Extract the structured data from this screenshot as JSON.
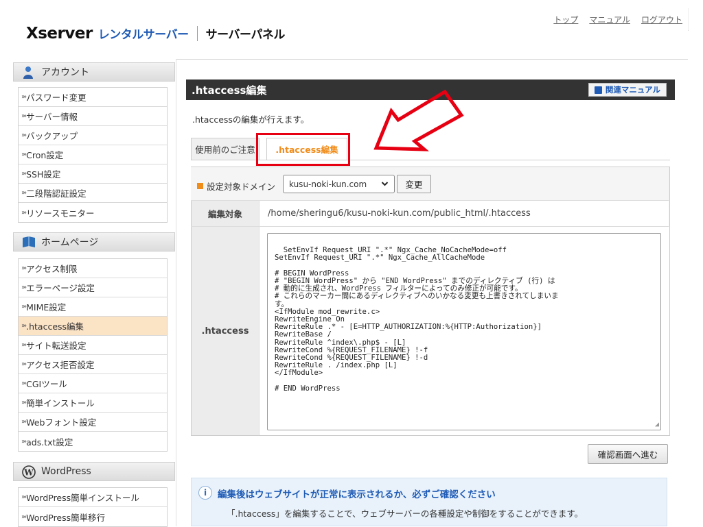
{
  "header": {
    "logo_brand": "Xserver",
    "logo_rental": "レンタルサーバー",
    "logo_panel": "サーバーパネル",
    "links": [
      "トップ",
      "マニュアル",
      "ログアウト"
    ]
  },
  "sidebar": {
    "account": {
      "title": "アカウント",
      "icon": "person-icon",
      "items": [
        "パスワード変更",
        "サーバー情報",
        "バックアップ",
        "Cron設定",
        "SSH設定",
        "二段階認証設定",
        "リソースモニター"
      ]
    },
    "homepage": {
      "title": "ホームページ",
      "icon": "book-icon",
      "items": [
        "アクセス制限",
        "エラーページ設定",
        "MIME設定",
        ".htaccess編集",
        "サイト転送設定",
        "アクセス拒否設定",
        "CGIツール",
        "簡単インストール",
        "Webフォント設定",
        "ads.txt設定"
      ],
      "active_index": 3
    },
    "wordpress": {
      "title": "WordPress",
      "icon": "wordpress-icon",
      "items": [
        "WordPress簡単インストール",
        "WordPress簡単移行"
      ]
    }
  },
  "main": {
    "title": ".htaccess編集",
    "manual_button": "関連マニュアル",
    "description": ".htaccessの編集が行えます。",
    "tabs": [
      "使用前のご注意",
      ".htaccess編集"
    ],
    "active_tab": 1,
    "domain_label": "設定対象ドメイン",
    "domain_value": "kusu-noki-kun.com",
    "change_button": "変更",
    "target_label": "編集対象",
    "target_path": "/home/sheringu6/kusu-noki-kun.com/public_html/.htaccess",
    "htaccess_label": ".htaccess",
    "editor_content": "SetEnvIf Request_URI \".*\" Ngx_Cache_NoCacheMode=off\nSetEnvIf Request_URI \".*\" Ngx_Cache_AllCacheMode\n\n# BEGIN WordPress\n# \"BEGIN WordPress\" から \"END WordPress\" までのディレクティブ (行) は\n# 動的に生成され、WordPress フィルターによってのみ修正が可能です。\n# これらのマーカー間にあるディレクティブへのいかなる変更も上書きされてしまいま\nす。\n<IfModule mod_rewrite.c>\nRewriteEngine On\nRewriteRule .* - [E=HTTP_AUTHORIZATION:%{HTTP:Authorization}]\nRewriteBase /\nRewriteRule ^index\\.php$ - [L]\nRewriteCond %{REQUEST_FILENAME} !-f\nRewriteCond %{REQUEST_FILENAME} !-d\nRewriteRule . /index.php [L]\n</IfModule>\n\n# END WordPress",
    "confirm_button": "確認画面へ進む",
    "info_title": "編集後はウェブサイトが正常に表示されるか、必ずご確認ください",
    "info_text": "「.htaccess」を編集することで、ウェブサーバーの各種設定や制御をすることができます。"
  },
  "colors": {
    "accent_orange": "#f08c1a",
    "brand_blue": "#1f5bb5",
    "highlight_red": "#e60012",
    "title_bar": "#333333"
  }
}
